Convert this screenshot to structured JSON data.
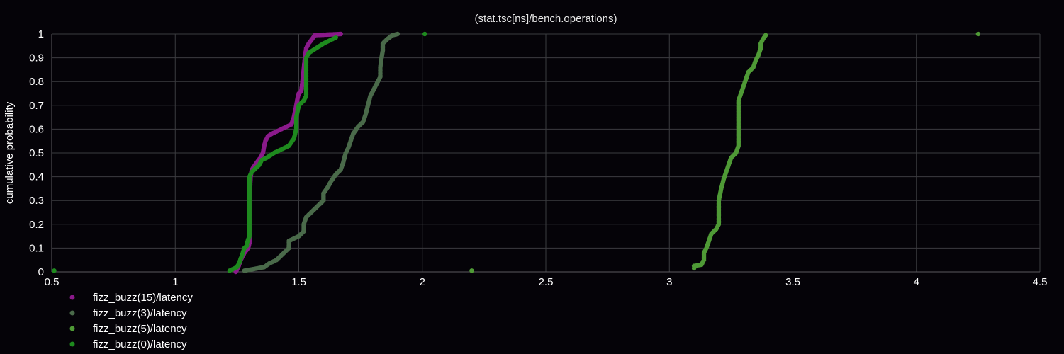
{
  "chart_data": {
    "type": "scatter",
    "title": "(stat.tsc[ns]/bench.operations)",
    "xlabel": "",
    "ylabel": "cumulative probability",
    "xlim": [
      0.5,
      4.5
    ],
    "ylim": [
      0,
      1
    ],
    "xticks": [
      "0.5",
      "1",
      "1.5",
      "2",
      "2.5",
      "3",
      "3.5",
      "4",
      "4.5"
    ],
    "yticks": [
      "0",
      "0.1",
      "0.2",
      "0.3",
      "0.4",
      "0.5",
      "0.6",
      "0.7",
      "0.8",
      "0.9",
      "1"
    ],
    "grid": true,
    "legend_position": "bottom-left",
    "series": [
      {
        "name": "fizz_buzz(15)/latency",
        "color": "#8b1a8b",
        "points": [
          [
            1.245,
            0.0
          ],
          [
            1.255,
            0.02
          ],
          [
            1.265,
            0.05
          ],
          [
            1.28,
            0.08
          ],
          [
            1.295,
            0.1
          ],
          [
            1.3,
            0.12
          ],
          [
            1.3,
            0.2
          ],
          [
            1.3,
            0.3
          ],
          [
            1.305,
            0.4
          ],
          [
            1.31,
            0.43
          ],
          [
            1.33,
            0.46
          ],
          [
            1.345,
            0.48
          ],
          [
            1.355,
            0.5
          ],
          [
            1.36,
            0.53
          ],
          [
            1.365,
            0.55
          ],
          [
            1.375,
            0.57
          ],
          [
            1.39,
            0.58
          ],
          [
            1.41,
            0.59
          ],
          [
            1.43,
            0.6
          ],
          [
            1.45,
            0.61
          ],
          [
            1.47,
            0.62
          ],
          [
            1.48,
            0.65
          ],
          [
            1.49,
            0.7
          ],
          [
            1.495,
            0.73
          ],
          [
            1.5,
            0.75
          ],
          [
            1.51,
            0.76
          ],
          [
            1.515,
            0.8
          ],
          [
            1.52,
            0.85
          ],
          [
            1.525,
            0.9
          ],
          [
            1.53,
            0.94
          ],
          [
            1.54,
            0.96
          ],
          [
            1.555,
            0.98
          ],
          [
            1.565,
            0.995
          ],
          [
            1.67,
            1.0
          ]
        ]
      },
      {
        "name": "fizz_buzz(3)/latency",
        "color": "#4a6a4a",
        "points": [
          [
            1.28,
            0.005
          ],
          [
            1.36,
            0.02
          ],
          [
            1.38,
            0.035
          ],
          [
            1.41,
            0.05
          ],
          [
            1.44,
            0.08
          ],
          [
            1.46,
            0.1
          ],
          [
            1.46,
            0.13
          ],
          [
            1.5,
            0.15
          ],
          [
            1.52,
            0.17
          ],
          [
            1.52,
            0.2
          ],
          [
            1.53,
            0.23
          ],
          [
            1.55,
            0.25
          ],
          [
            1.58,
            0.28
          ],
          [
            1.6,
            0.3
          ],
          [
            1.6,
            0.33
          ],
          [
            1.62,
            0.36
          ],
          [
            1.63,
            0.38
          ],
          [
            1.65,
            0.41
          ],
          [
            1.67,
            0.43
          ],
          [
            1.68,
            0.46
          ],
          [
            1.69,
            0.5
          ],
          [
            1.7,
            0.52
          ],
          [
            1.71,
            0.55
          ],
          [
            1.72,
            0.58
          ],
          [
            1.74,
            0.61
          ],
          [
            1.76,
            0.63
          ],
          [
            1.77,
            0.66
          ],
          [
            1.78,
            0.7
          ],
          [
            1.79,
            0.74
          ],
          [
            1.81,
            0.78
          ],
          [
            1.82,
            0.8
          ],
          [
            1.83,
            0.82
          ],
          [
            1.83,
            0.86
          ],
          [
            1.835,
            0.9
          ],
          [
            1.84,
            0.93
          ],
          [
            1.84,
            0.96
          ],
          [
            1.86,
            0.98
          ],
          [
            1.88,
            0.995
          ],
          [
            1.9,
            1.0
          ]
        ]
      },
      {
        "name": "fizz_buzz(5)/latency",
        "color": "#4f9a36",
        "points": [
          [
            2.2,
            0.005
          ],
          [
            3.1,
            0.015
          ],
          [
            3.1,
            0.025
          ],
          [
            3.13,
            0.03
          ],
          [
            3.14,
            0.05
          ],
          [
            3.14,
            0.08
          ],
          [
            3.15,
            0.1
          ],
          [
            3.16,
            0.13
          ],
          [
            3.17,
            0.16
          ],
          [
            3.19,
            0.18
          ],
          [
            3.2,
            0.2
          ],
          [
            3.2,
            0.25
          ],
          [
            3.2,
            0.3
          ],
          [
            3.21,
            0.35
          ],
          [
            3.22,
            0.39
          ],
          [
            3.23,
            0.42
          ],
          [
            3.24,
            0.45
          ],
          [
            3.25,
            0.48
          ],
          [
            3.27,
            0.5
          ],
          [
            3.28,
            0.53
          ],
          [
            3.28,
            0.58
          ],
          [
            3.28,
            0.63
          ],
          [
            3.28,
            0.68
          ],
          [
            3.28,
            0.72
          ],
          [
            3.29,
            0.75
          ],
          [
            3.3,
            0.78
          ],
          [
            3.31,
            0.81
          ],
          [
            3.32,
            0.84
          ],
          [
            3.34,
            0.86
          ],
          [
            3.35,
            0.89
          ],
          [
            3.36,
            0.91
          ],
          [
            3.37,
            0.94
          ],
          [
            3.37,
            0.96
          ],
          [
            3.38,
            0.98
          ],
          [
            3.39,
            0.995
          ],
          [
            4.25,
            1.0
          ]
        ]
      },
      {
        "name": "fizz_buzz(0)/latency",
        "color": "#1e8a1e",
        "points": [
          [
            0.51,
            0.005
          ],
          [
            1.22,
            0.005
          ],
          [
            1.25,
            0.02
          ],
          [
            1.26,
            0.04
          ],
          [
            1.27,
            0.07
          ],
          [
            1.28,
            0.1
          ],
          [
            1.29,
            0.11
          ],
          [
            1.29,
            0.12
          ],
          [
            1.3,
            0.15
          ],
          [
            1.3,
            0.2
          ],
          [
            1.3,
            0.25
          ],
          [
            1.3,
            0.3
          ],
          [
            1.3,
            0.35
          ],
          [
            1.3,
            0.4
          ],
          [
            1.31,
            0.42
          ],
          [
            1.34,
            0.45
          ],
          [
            1.35,
            0.47
          ],
          [
            1.37,
            0.48
          ],
          [
            1.4,
            0.5
          ],
          [
            1.42,
            0.51
          ],
          [
            1.44,
            0.52
          ],
          [
            1.46,
            0.53
          ],
          [
            1.48,
            0.56
          ],
          [
            1.49,
            0.6
          ],
          [
            1.49,
            0.65
          ],
          [
            1.5,
            0.7
          ],
          [
            1.52,
            0.72
          ],
          [
            1.53,
            0.74
          ],
          [
            1.53,
            0.78
          ],
          [
            1.53,
            0.82
          ],
          [
            1.53,
            0.86
          ],
          [
            1.53,
            0.9
          ],
          [
            1.54,
            0.92
          ],
          [
            1.57,
            0.94
          ],
          [
            1.6,
            0.96
          ],
          [
            1.63,
            0.975
          ],
          [
            1.65,
            0.985
          ],
          [
            2.01,
            1.0
          ]
        ]
      }
    ]
  }
}
